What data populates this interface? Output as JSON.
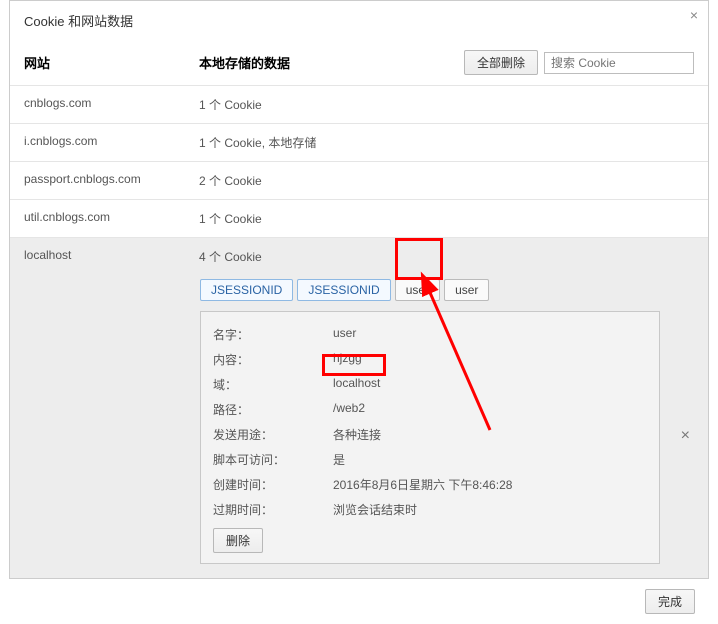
{
  "title": "Cookie 和网站数据",
  "columns": {
    "site": "网站",
    "data": "本地存储的数据"
  },
  "actions": {
    "delete_all": "全部删除",
    "done": "完成",
    "delete": "删除"
  },
  "search": {
    "placeholder": "搜索 Cookie"
  },
  "rows": [
    {
      "site": "cnblogs.com",
      "data": "1 个 Cookie"
    },
    {
      "site": "i.cnblogs.com",
      "data": "1 个 Cookie, 本地存储"
    },
    {
      "site": "passport.cnblogs.com",
      "data": "2 个 Cookie"
    },
    {
      "site": "util.cnblogs.com",
      "data": "1 个 Cookie"
    },
    {
      "site": "localhost",
      "data": "4 个 Cookie"
    }
  ],
  "tags": [
    "JSESSIONID",
    "JSESSIONID",
    "user",
    "user"
  ],
  "detail": {
    "labels": {
      "name": "名字：",
      "content": "内容：",
      "domain": "域：",
      "path": "路径：",
      "send": "发送用途：",
      "script": "脚本可访问：",
      "created": "创建时间：",
      "expires": "过期时间："
    },
    "values": {
      "name": "user",
      "content": "hjzgg",
      "domain": "localhost",
      "path": "/web2",
      "send": "各种连接",
      "script": "是",
      "created": "2016年8月6日星期六 下午8:46:28",
      "expires": "浏览会话结束时"
    }
  }
}
